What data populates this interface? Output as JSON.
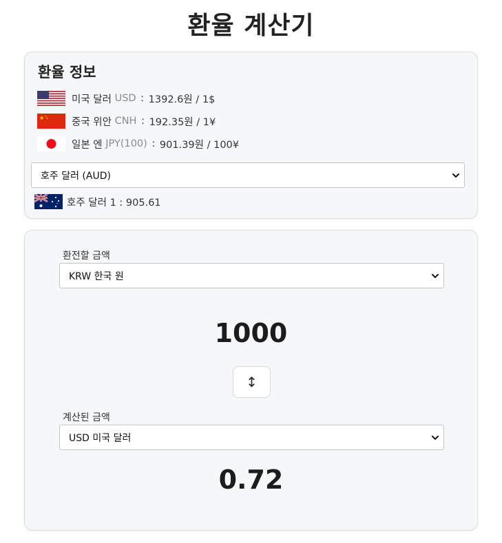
{
  "title": "환율 계산기",
  "rate_info": {
    "heading": "환율 정보",
    "rates": [
      {
        "flag_icon": "us-flag-icon",
        "name": "미국 달러",
        "code": "USD",
        "sep": ":",
        "value": "1392.6원 / 1$"
      },
      {
        "flag_icon": "cn-flag-icon",
        "name": "중국 위안",
        "code": "CNH",
        "sep": ":",
        "value": "192.35원 / 1¥"
      },
      {
        "flag_icon": "jp-flag-icon",
        "name": "일본 엔",
        "code": "JPY(100)",
        "sep": ":",
        "value": "901.39원 / 100¥"
      }
    ],
    "country_select": {
      "value": "호주 달러 (AUD)"
    },
    "selected_rate": {
      "flag_icon": "au-flag-icon",
      "text": "호주 달러 1 : 905.61"
    }
  },
  "calculator": {
    "from_label": "환전할 금액",
    "from_currency": "KRW 한국 원",
    "amount": "1000",
    "swap_icon": "↕",
    "to_label": "계산된 금액",
    "to_currency": "USD 미국 달러",
    "result": "0.72"
  },
  "colors": {
    "card_bg": "#f6f7f9",
    "card_border": "#dcdcdc",
    "code_gray": "#8a8a8a",
    "text_dark": "#222222"
  }
}
